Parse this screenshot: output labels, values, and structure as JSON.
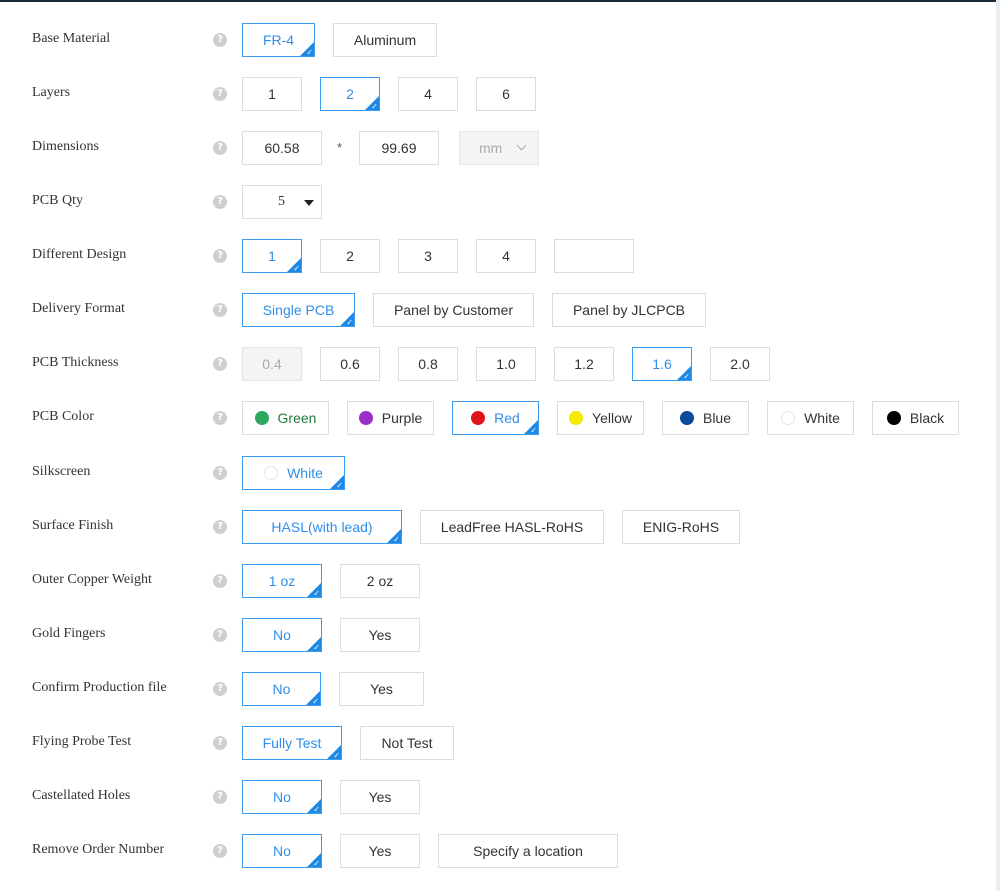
{
  "help_glyph": "?",
  "rows": {
    "base_material": {
      "label": "Base Material",
      "options": [
        "FR-4",
        "Aluminum"
      ]
    },
    "layers": {
      "label": "Layers",
      "options": [
        "1",
        "2",
        "4",
        "6"
      ]
    },
    "dimensions": {
      "label": "Dimensions",
      "width": "60.58",
      "separator": "*",
      "height": "99.69",
      "unit": "mm"
    },
    "pcb_qty": {
      "label": "PCB Qty",
      "value": "5"
    },
    "different_design": {
      "label": "Different Design",
      "options": [
        "1",
        "2",
        "3",
        "4"
      ],
      "custom_value": ""
    },
    "delivery_format": {
      "label": "Delivery Format",
      "options": [
        "Single PCB",
        "Panel by Customer",
        "Panel by JLCPCB"
      ]
    },
    "pcb_thickness": {
      "label": "PCB Thickness",
      "options": [
        "0.4",
        "0.6",
        "0.8",
        "1.0",
        "1.2",
        "1.6",
        "2.0"
      ]
    },
    "pcb_color": {
      "label": "PCB Color",
      "options": [
        {
          "name": "Green",
          "color": "#2ea85f",
          "text_color": "#1f7a3a"
        },
        {
          "name": "Purple",
          "color": "#9b2fc9",
          "text_color": "#333333"
        },
        {
          "name": "Red",
          "color": "#e0131b",
          "text_color": "#2f8fe8"
        },
        {
          "name": "Yellow",
          "color": "#f6ea00",
          "text_color": "#333333"
        },
        {
          "name": "Blue",
          "color": "#0b4a9c",
          "text_color": "#333333"
        },
        {
          "name": "White",
          "color": "#ffffff",
          "text_color": "#333333"
        },
        {
          "name": "Black",
          "color": "#000000",
          "text_color": "#333333"
        }
      ]
    },
    "silkscreen": {
      "label": "Silkscreen",
      "options": [
        "White"
      ]
    },
    "surface_finish": {
      "label": "Surface Finish",
      "options": [
        "HASL(with lead)",
        "LeadFree HASL-RoHS",
        "ENIG-RoHS"
      ]
    },
    "outer_copper_weight": {
      "label": "Outer Copper Weight",
      "options": [
        "1 oz",
        "2 oz"
      ]
    },
    "gold_fingers": {
      "label": "Gold Fingers",
      "options": [
        "No",
        "Yes"
      ]
    },
    "confirm_production_file": {
      "label": "Confirm Production file",
      "options": [
        "No",
        "Yes"
      ]
    },
    "flying_probe_test": {
      "label": "Flying Probe Test",
      "options": [
        "Fully Test",
        "Not Test"
      ]
    },
    "castellated_holes": {
      "label": "Castellated Holes",
      "options": [
        "No",
        "Yes"
      ]
    },
    "remove_order_number": {
      "label": "Remove Order Number",
      "options": [
        "No",
        "Yes",
        "Specify a location"
      ]
    }
  },
  "colors": {
    "accent": "#2f8fe8",
    "accent_border": "#3c9cf0",
    "corner": "#1e88e5",
    "border": "#dcdcdc",
    "disabled_bg": "#f4f4f4"
  }
}
